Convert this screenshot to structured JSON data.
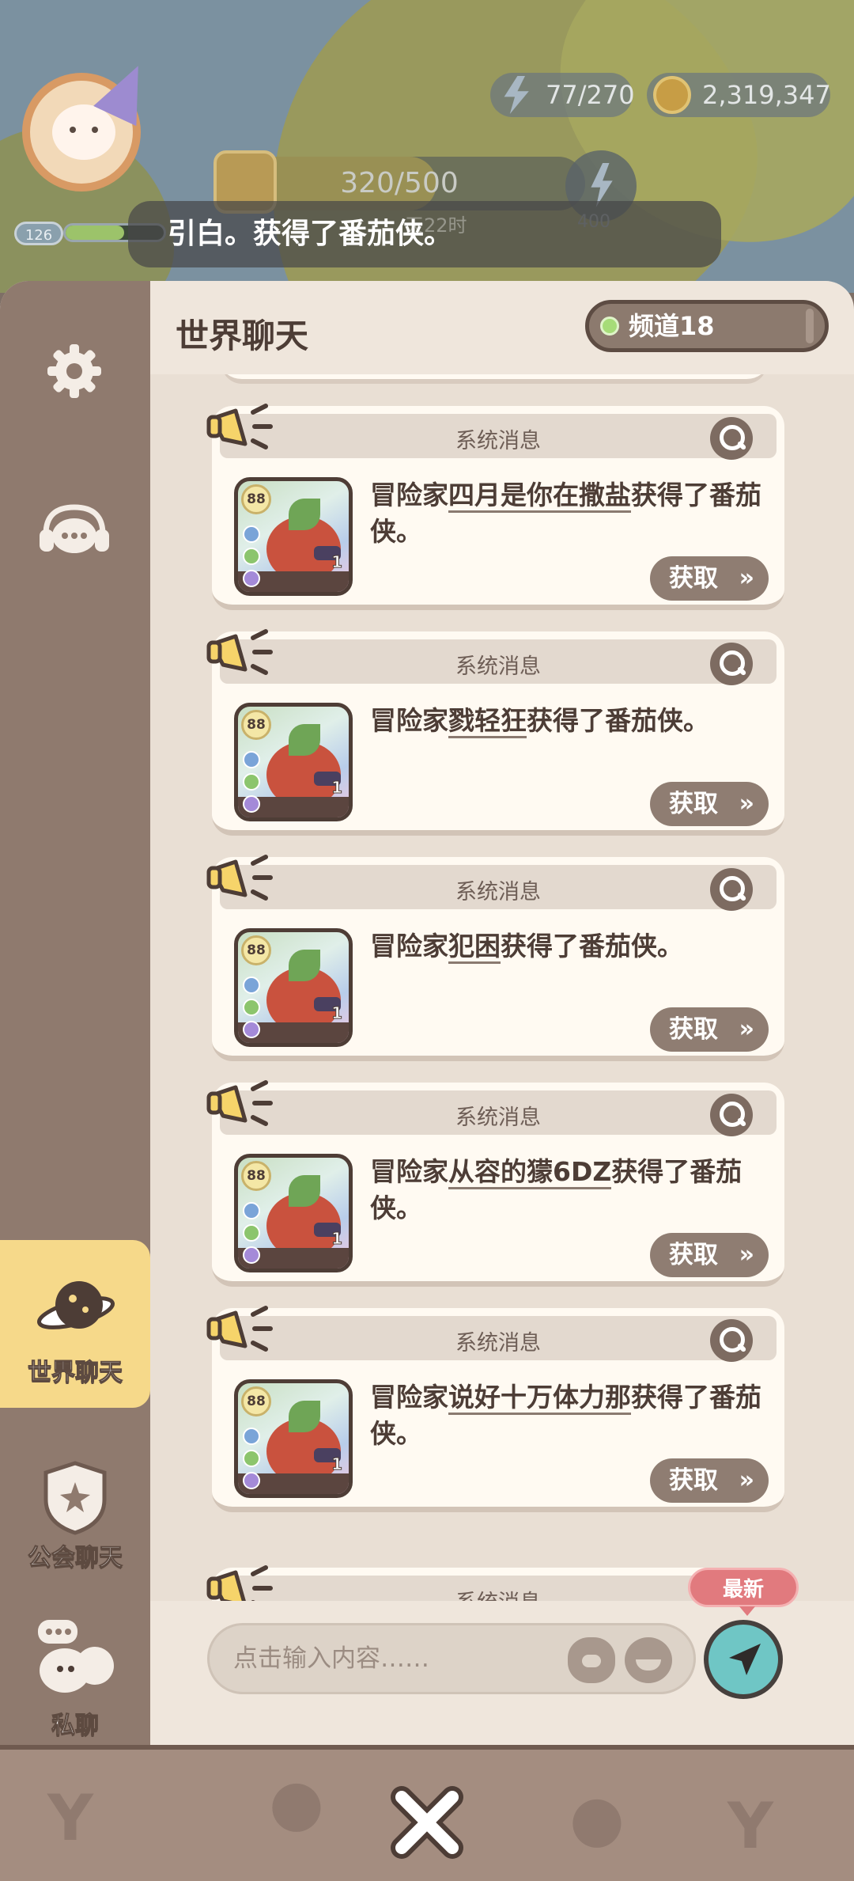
{
  "hud": {
    "player_level": "126",
    "energy": "77/270",
    "gold": "2,319,347",
    "stamina": "320/500",
    "stamina_note": "天22时",
    "bolt_count": "400",
    "marquee": "引白。获得了番茄侠。"
  },
  "sidebar": {
    "settings_icon": "gear-icon",
    "support_icon": "headset-chat-icon",
    "world_label": "世界聊天",
    "guild_label": "公会聊天",
    "private_label": "私聊"
  },
  "header": {
    "title": "世界聊天",
    "channel": "频道18"
  },
  "messages": [
    {
      "type": "系统消息",
      "prefix": "冒险家",
      "name": "四月是你在撒盐",
      "suffix": "获得了番茄侠。",
      "rank": "88",
      "count": "1",
      "action": "获取"
    },
    {
      "type": "系统消息",
      "prefix": "冒险家",
      "name": "戮轻狂",
      "suffix": "获得了番茄侠。",
      "rank": "88",
      "count": "1",
      "action": "获取"
    },
    {
      "type": "系统消息",
      "prefix": "冒险家",
      "name": "犯困",
      "suffix": "获得了番茄侠。",
      "rank": "88",
      "count": "1",
      "action": "获取"
    },
    {
      "type": "系统消息",
      "prefix": "冒险家",
      "name": "从容的獴6DZ",
      "suffix": "获得了番茄侠。",
      "rank": "88",
      "count": "1",
      "action": "获取"
    },
    {
      "type": "系统消息",
      "prefix": "冒险家",
      "name": "说好十万体力那",
      "suffix": "获得了番茄侠。",
      "rank": "88",
      "count": "1",
      "action": "获取"
    }
  ],
  "partial_message": {
    "type": "系统消息"
  },
  "input": {
    "placeholder": "点击输入内容……",
    "newest_label": "最新"
  },
  "colors": {
    "panel_bg": "#efe6dc",
    "sidebar_bg": "#8f7a6e",
    "active_tab": "#f6d98a",
    "send_button": "#6fc6c5",
    "newest_badge": "#e17a7e"
  }
}
